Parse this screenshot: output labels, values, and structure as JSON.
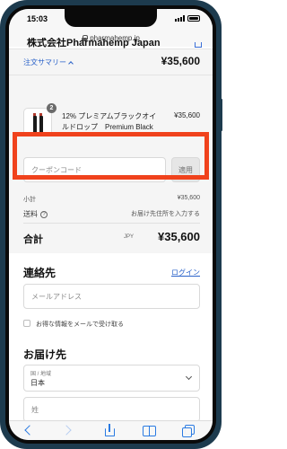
{
  "status_bar": {
    "time": "15:03"
  },
  "browser": {
    "url": "pharmahemp.jp"
  },
  "header": {
    "shop_name": "株式会社Pharmahemp Japan"
  },
  "order_summary": {
    "toggle_label": "注文サマリー",
    "total": "¥35,600",
    "item": {
      "name": "12% プレミアムブラックオイルドロップ　Premium Black",
      "price": "¥35,600",
      "quantity": "2"
    },
    "coupon": {
      "placeholder": "クーポンコード",
      "apply_label": "適用"
    },
    "subtotal_label": "小計",
    "subtotal_value": "¥35,600",
    "shipping_label": "送料",
    "shipping_value": "お届け先住所を入力する",
    "total_label": "合計",
    "currency": "JPY",
    "total_value": "¥35,600"
  },
  "contact": {
    "heading": "連絡先",
    "login_label": "ログイン",
    "email_placeholder": "メールアドレス",
    "newsletter_label": "お得な情報をメールで受け取る"
  },
  "shipping": {
    "heading": "お届け先",
    "country_label": "国 / 地域",
    "country_value": "日本",
    "lastname_placeholder": "姓"
  },
  "colors": {
    "highlight": "#f0421c",
    "link": "#2a62c9",
    "frame": "#1d3b4e"
  },
  "icons": [
    "lock-icon",
    "cart-icon",
    "chevron-up-icon",
    "info-icon",
    "chevron-down-icon",
    "back-icon",
    "forward-icon",
    "share-icon",
    "bookmarks-icon",
    "tabs-icon"
  ]
}
